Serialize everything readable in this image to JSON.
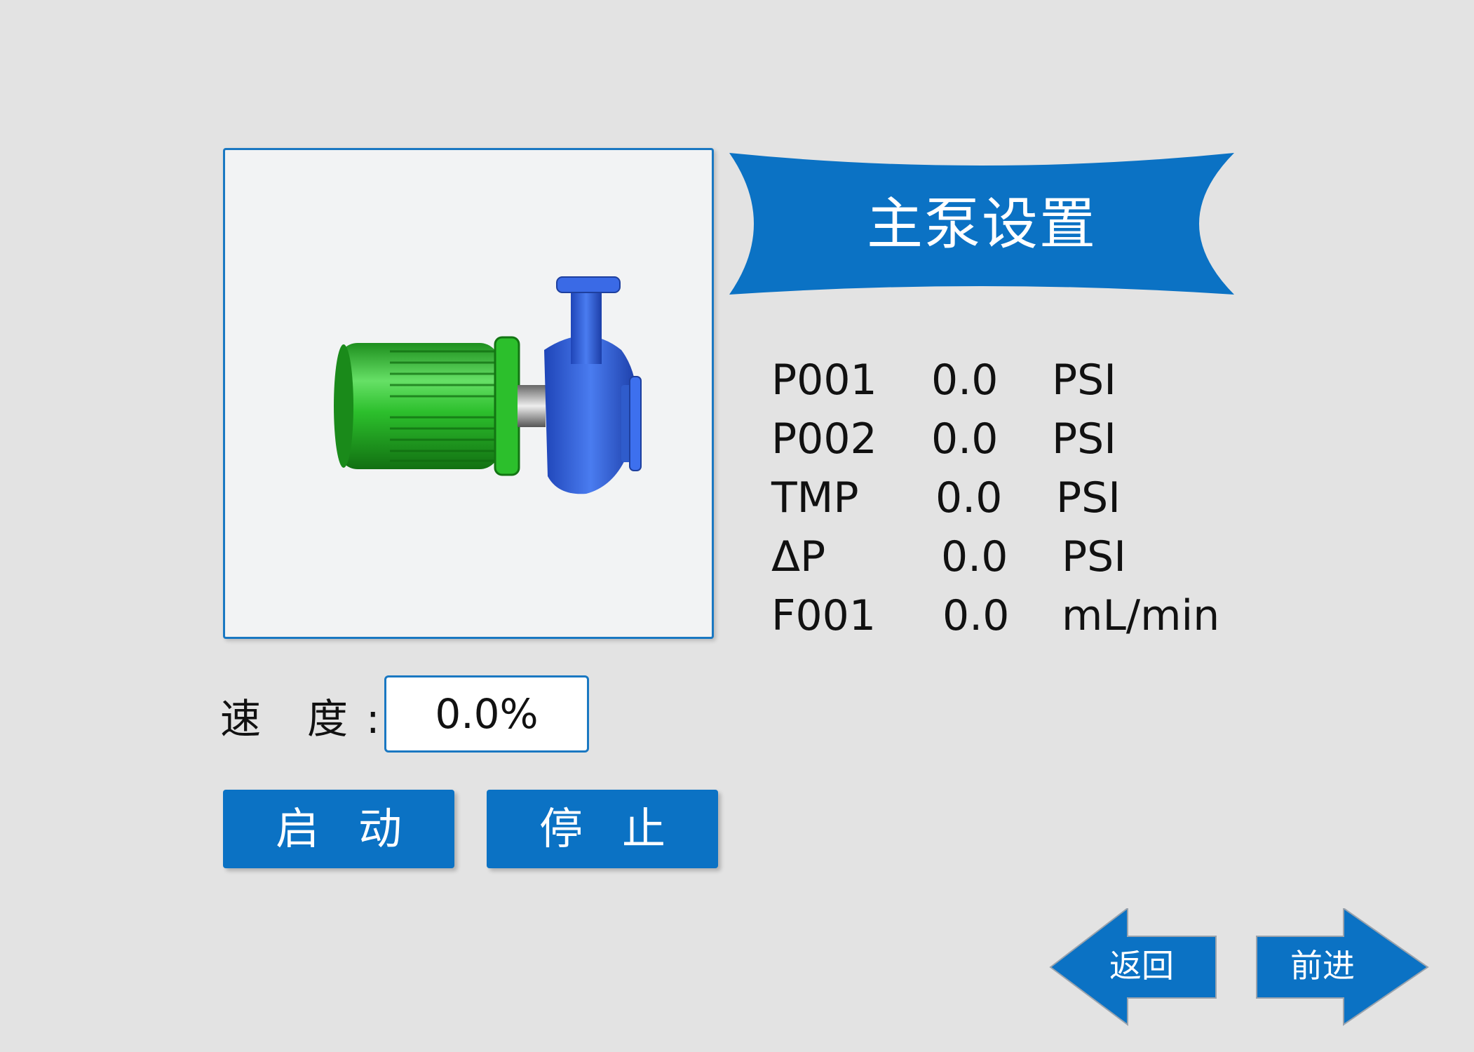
{
  "page": {
    "title": "主泵设置"
  },
  "pump_image": {
    "icon": "centrifugal-pump-icon",
    "motor_color": "#28b22a",
    "casing_color": "#2d5fd8"
  },
  "readings": [
    {
      "name": "P001",
      "value": "0.0",
      "unit": "PSI"
    },
    {
      "name": "P002",
      "value": "0.0",
      "unit": "PSI"
    },
    {
      "name": "TMP",
      "value": "0.0",
      "unit": "PSI"
    },
    {
      "name": "ΔP",
      "value": "0.0",
      "unit": "PSI"
    },
    {
      "name": "F001",
      "value": "0.0",
      "unit": "mL/min"
    }
  ],
  "speed": {
    "label_char1": "速",
    "label_char2": "度",
    "label_colon": ":",
    "value": "0.0%"
  },
  "buttons": {
    "start_label": "启动",
    "stop_label": "停止"
  },
  "nav": {
    "back_label": "返回",
    "forward_label": "前进"
  },
  "colors": {
    "accent": "#0b72c4",
    "background": "#e3e3e3",
    "panel": "#f2f3f4"
  }
}
